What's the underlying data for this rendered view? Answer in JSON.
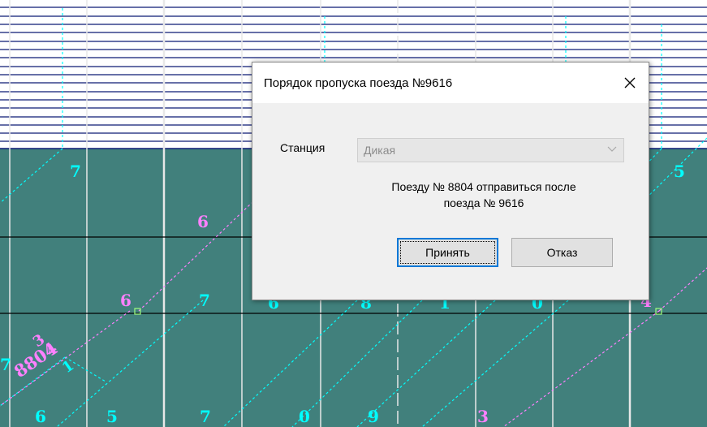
{
  "graph": {
    "numbers": [
      {
        "text": "7",
        "color": "#00ffff"
      },
      {
        "text": "5",
        "color": "#00ffff"
      },
      {
        "text": "6",
        "color": "#ff80ff"
      },
      {
        "text": "6",
        "color": "#ff80ff"
      },
      {
        "text": "7",
        "color": "#00ffff"
      },
      {
        "text": "6",
        "color": "#00ffff"
      },
      {
        "text": "8",
        "color": "#00ffff"
      },
      {
        "text": "1",
        "color": "#00ffff"
      },
      {
        "text": "0",
        "color": "#00ffff"
      },
      {
        "text": "4",
        "color": "#ff80ff"
      },
      {
        "text": "6",
        "color": "#00ffff"
      },
      {
        "text": "5",
        "color": "#00ffff"
      },
      {
        "text": "7",
        "color": "#00ffff"
      },
      {
        "text": "0",
        "color": "#00ffff"
      },
      {
        "text": "9",
        "color": "#00ffff"
      },
      {
        "text": "3",
        "color": "#ff80ff"
      },
      {
        "text": "7",
        "color": "#00ffff"
      }
    ],
    "train_label": "8804",
    "train_sub_labels": [
      "3",
      "4",
      "1"
    ]
  },
  "dialog": {
    "title": "Порядок пропуска поезда №9616",
    "station_label": "Станция",
    "station_value": "Дикая",
    "message_line1": "Поезду № 8804 отправиться после",
    "message_line2": "поезда № 9616",
    "accept_label": "Принять",
    "cancel_label": "Отказ"
  },
  "colors": {
    "teal": "#41807c",
    "navy_track": "#0c1a74",
    "cyan": "#00ffff",
    "magenta": "#ff80ff",
    "accent": "#0078d7"
  }
}
